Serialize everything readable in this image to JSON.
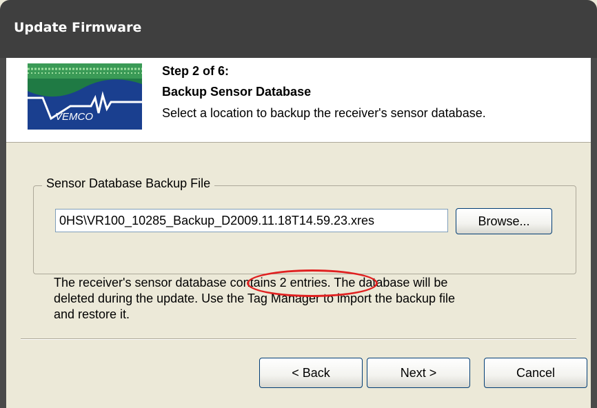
{
  "window": {
    "title": "Update Firmware"
  },
  "header": {
    "step": "Step 2 of 6:",
    "subtitle": "Backup Sensor Database",
    "description": "Select a location to backup the receiver's sensor database.",
    "logo_text": "VEMCO"
  },
  "backup_group": {
    "label": "Sensor Database Backup File",
    "file_path": "0HS\\VR100_10285_Backup_D2009.11.18T14.59.23.xres",
    "browse_label": "Browse..."
  },
  "info": {
    "lines": [
      "The receiver's sensor database contains 2 entries. The database will be",
      "deleted during the update. Use the Tag Manager to import the backup file",
      "and restore it."
    ]
  },
  "buttons": {
    "back": "< Back",
    "next": "Next >",
    "cancel": "Cancel"
  },
  "colors": {
    "title_bar": "#3f3f3f",
    "dialog_bg": "#ece9d8",
    "highlight": "#e02020",
    "logo_bg": "#1a3f8f"
  }
}
